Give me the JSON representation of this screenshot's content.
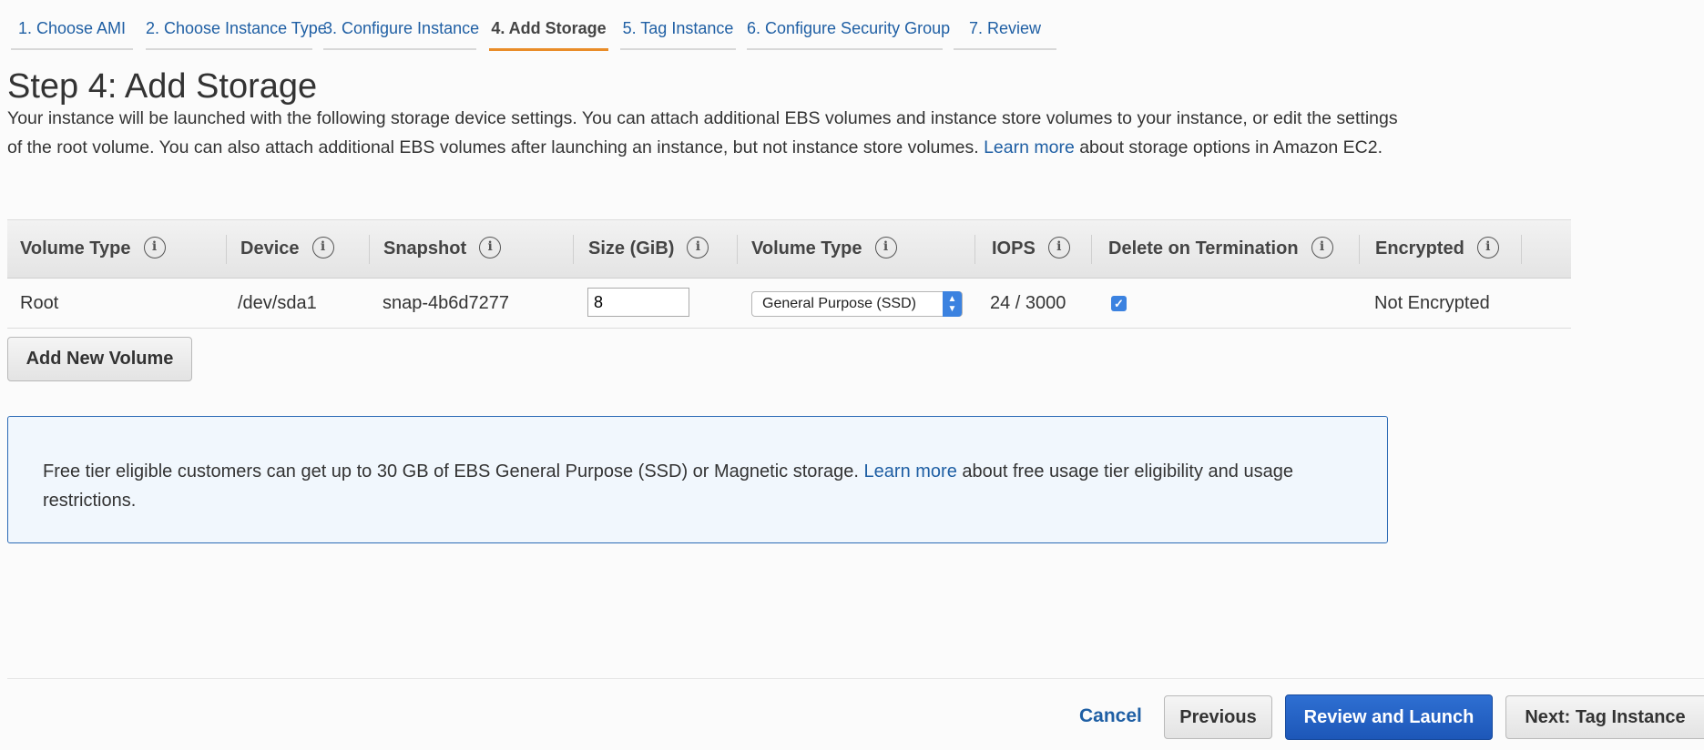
{
  "wizard": {
    "tabs": [
      {
        "label": "1. Choose AMI"
      },
      {
        "label": "2. Choose Instance Type"
      },
      {
        "label": "3. Configure Instance"
      },
      {
        "label": "4. Add Storage"
      },
      {
        "label": "5. Tag Instance"
      },
      {
        "label": "6. Configure Security Group"
      },
      {
        "label": "7. Review"
      }
    ],
    "active_tab": "4. Add Storage"
  },
  "page": {
    "title": "Step 4: Add Storage",
    "description_1": "Your instance will be launched with the following storage device settings. You can attach additional EBS volumes and instance store volumes to your instance, or edit the settings of the root volume. You can also attach additional EBS volumes after launching an instance, but not instance store volumes. ",
    "learn_more": "Learn more",
    "description_2": " about storage options in Amazon EC2."
  },
  "table": {
    "headers": [
      "Volume Type",
      "Device",
      "Snapshot",
      "Size (GiB)",
      "Volume Type",
      "IOPS",
      "Delete on Termination",
      "Encrypted"
    ],
    "info_icon": "i",
    "rows": [
      {
        "volume_type": "Root",
        "device": "/dev/sda1",
        "snapshot": "snap-4b6d7277",
        "size": "8",
        "ebs_type": "General Purpose (SSD)",
        "iops": "24 / 3000",
        "delete_on_termination": true,
        "encrypted": "Not Encrypted"
      }
    ]
  },
  "add_volume_button": "Add New Volume",
  "notice": {
    "text_1": "Free tier eligible customers can get up to 30 GB of EBS General Purpose (SSD) or Magnetic storage. ",
    "learn_more": "Learn more",
    "text_2": " about free usage tier eligibility and usage restrictions."
  },
  "footer": {
    "cancel": "Cancel",
    "previous": "Previous",
    "review_and_launch": "Review and Launch",
    "next": "Next: Tag Instance"
  },
  "colors": {
    "link": "#1f5fa4",
    "active_tab_underline": "#e98c28",
    "primary_button": "#2462c6",
    "notice_border": "#2b6ab5",
    "notice_background": "#f1f7fd"
  }
}
